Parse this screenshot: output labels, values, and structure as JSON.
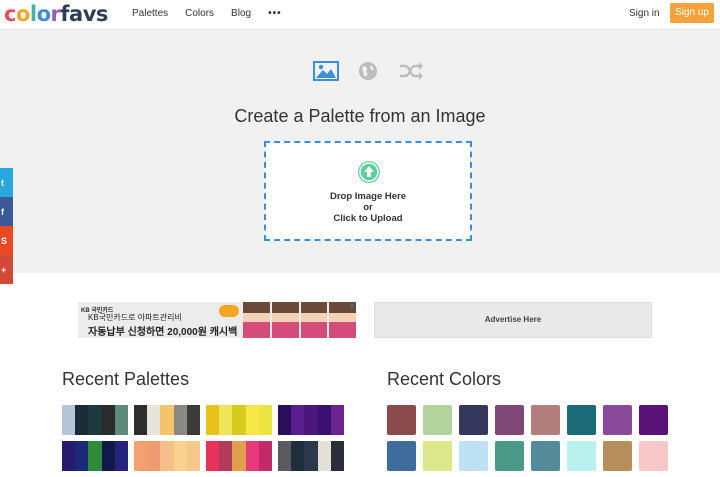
{
  "header": {
    "logo_letters": [
      {
        "ch": "c",
        "color": "#e84a5f"
      },
      {
        "ch": "o",
        "color": "#f5a623"
      },
      {
        "ch": "l",
        "color": "#4ab0a4"
      },
      {
        "ch": "o",
        "color": "#3a8fd8"
      },
      {
        "ch": "r",
        "color": "#9b59b6"
      },
      {
        "ch": "f",
        "color": "#2c3e50"
      },
      {
        "ch": "a",
        "color": "#2c3e50"
      },
      {
        "ch": "v",
        "color": "#2c3e50"
      },
      {
        "ch": "s",
        "color": "#2c3e50"
      }
    ],
    "nav": [
      "Palettes",
      "Colors",
      "Blog"
    ],
    "more": "•••",
    "signin": "Sign in",
    "signup": "Sign up"
  },
  "hero": {
    "mode_icons": [
      "image-icon",
      "globe-icon",
      "shuffle-icon"
    ],
    "title": "Create a Palette from an Image",
    "drop_line1": "Drop Image Here",
    "drop_line2": "or",
    "drop_line3": "Click to Upload"
  },
  "social": [
    {
      "name": "twitter-icon",
      "glyph": "t",
      "color": "#29a8e0"
    },
    {
      "name": "facebook-icon",
      "glyph": "f",
      "color": "#3b5998"
    },
    {
      "name": "stumbleupon-icon",
      "glyph": "S",
      "color": "#eb4924"
    },
    {
      "name": "googleplus-icon",
      "glyph": "+",
      "color": "#d34836"
    }
  ],
  "ads": {
    "ad_logo": "KB 국민카드",
    "ad_line1": "KB국민카드로 아파트관리비",
    "ad_line2": "자동납부 신청하면 20,000원 캐시백",
    "ad_close": "x",
    "advertise_label": "Advertise Here"
  },
  "sections": {
    "palettes_title": "Recent Palettes",
    "colors_title": "Recent Colors"
  },
  "palettes": [
    [
      "#b7c3d6",
      "#1a2a38",
      "#1e3a3e",
      "#2b2b2b",
      "#5d8a7a"
    ],
    [
      "#2e2e2e",
      "#e6e4dc",
      "#f5c36b",
      "#8a8a85",
      "#3b3b3b"
    ],
    [
      "#e7c31c",
      "#f0e45a",
      "#d7cc1e",
      "#f6e947",
      "#ece440"
    ],
    [
      "#2c0f5a",
      "#5a1e8c",
      "#4c1680",
      "#3a0f6e",
      "#6a248f"
    ],
    [
      "#2a1a6e",
      "#1b2a78",
      "#2f8a3a",
      "#0f1a4a",
      "#23247c"
    ],
    [
      "#f4a070",
      "#f09a72",
      "#f7c08a",
      "#fbd18e",
      "#f6c98a"
    ],
    [
      "#e8325a",
      "#b23a5a",
      "#e0a050",
      "#e83a7a",
      "#c12a6a"
    ],
    [
      "#5a5a60",
      "#1e2e3a",
      "#2a3a4a",
      "#e4e0d6",
      "#2b2e3a"
    ]
  ],
  "colors": [
    "#8b4a4c",
    "#b3d39c",
    "#34385c",
    "#814876",
    "#b37f7c",
    "#1c6b78",
    "#8a4a9c",
    "#5a1278",
    "#3f6d9b",
    "#dde78c",
    "#bde1f5",
    "#4a9a87",
    "#538c98",
    "#b7f2ef",
    "#b58e5c",
    "#f8c7c7"
  ],
  "accent_colors": {
    "signup": "#f5a23a",
    "dropzone_border": "#3a8fd8",
    "upload": "#5ccf9a"
  }
}
